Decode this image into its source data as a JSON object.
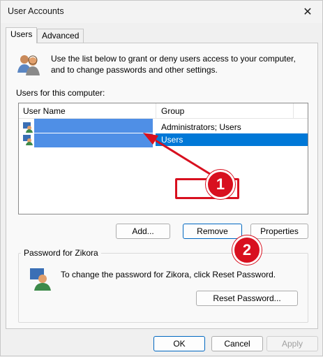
{
  "window": {
    "title": "User Accounts"
  },
  "tabs": [
    {
      "label": "Users",
      "active": true
    },
    {
      "label": "Advanced",
      "active": false
    }
  ],
  "intro": {
    "line1": "Use the list below to grant or deny users access to your computer,",
    "line2": "and to change passwords and other settings."
  },
  "users_list": {
    "label": "Users for this computer:",
    "columns": [
      "User Name",
      "Group"
    ],
    "rows": [
      {
        "user_name": "",
        "group": "Administrators; Users",
        "selected": false
      },
      {
        "user_name": "",
        "group": "Users",
        "selected": true
      }
    ]
  },
  "list_buttons": {
    "add": "Add...",
    "remove": "Remove",
    "properties": "Properties"
  },
  "password_group": {
    "title": "Password for Zikora",
    "text": "To change the password for Zikora, click Reset Password.",
    "reset_button": "Reset Password..."
  },
  "dialog_buttons": {
    "ok": "OK",
    "cancel": "Cancel",
    "apply": "Apply"
  },
  "annotations": {
    "callout_1": "1",
    "callout_2": "2",
    "accent_color": "#d8101f"
  },
  "colors": {
    "selection": "#0078d7",
    "redacted_name": "#4f8fe6"
  }
}
